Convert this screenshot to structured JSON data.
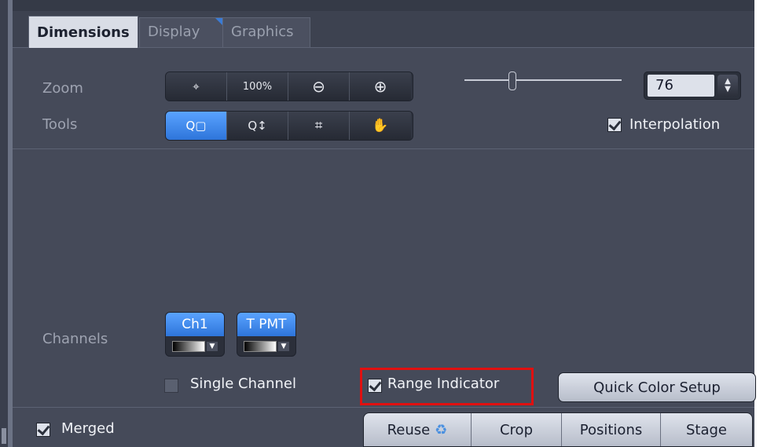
{
  "tabs": {
    "dimensions": "Dimensions",
    "display": "Display",
    "graphics": "Graphics"
  },
  "zoom": {
    "label": "Zoom",
    "buttons": [
      "⌖",
      "100%",
      "⊖",
      "⊕"
    ],
    "slider_value": 76,
    "value": "76"
  },
  "tools": {
    "label": "Tools",
    "buttons": [
      "Q▢",
      "Q↕",
      "⌗",
      "✋"
    ]
  },
  "interpolation": {
    "label": "Interpolation",
    "checked": true
  },
  "channels": {
    "label": "Channels",
    "items": [
      "Ch1",
      "T PMT"
    ]
  },
  "single_channel": {
    "label": "Single Channel",
    "checked": false
  },
  "range_indicator": {
    "label": "Range Indicator",
    "checked": true
  },
  "quick_color_setup": "Quick Color Setup",
  "merged": {
    "label": "Merged",
    "checked": true
  },
  "bottom_buttons": {
    "reuse": "Reuse",
    "crop": "Crop",
    "positions": "Positions",
    "stage": "Stage"
  },
  "colors": {
    "panel": "#454a59",
    "active_blue": "#3a86f0",
    "highlight": "#e01010"
  }
}
